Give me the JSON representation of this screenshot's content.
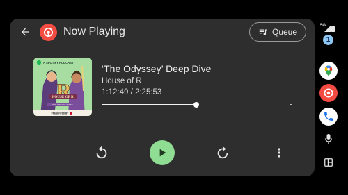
{
  "header": {
    "title": "Now Playing",
    "queue_label": "Queue"
  },
  "episode": {
    "title": "‘The Odyssey’ Deep Dive",
    "podcast": "House of R",
    "time": "1:12:49 / 2:25:53",
    "progress": 0.4989
  },
  "artwork": {
    "top_text": "A SPOTIFY PODCAST",
    "logo_text": "HOUSE OF R",
    "subtitle": "THE RINGER-VERSE",
    "presented_by": "PRESENTED BY"
  },
  "rail": {
    "status_label": "5G",
    "notification_count": "1"
  },
  "colors": {
    "panel": "#2e2e2e",
    "play_button": "#8fdc93",
    "podcast_addict_red": "#f44b42",
    "artwork_bg": "#a6dfa0"
  }
}
